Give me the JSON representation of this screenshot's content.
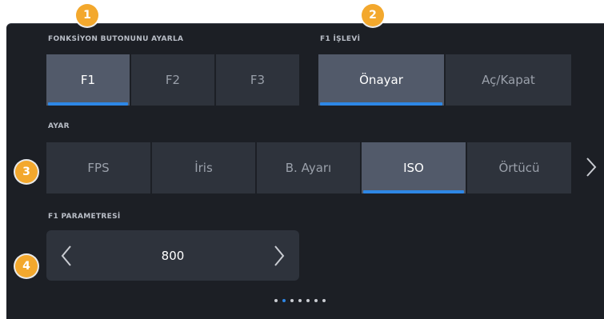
{
  "markers": [
    "1",
    "2",
    "3",
    "4"
  ],
  "function_button": {
    "label": "FONKSİYON BUTONUNU AYARLA",
    "options": [
      "F1",
      "F2",
      "F3"
    ],
    "selected": "F1"
  },
  "f1_function": {
    "label": "F1 İŞLEVİ",
    "options": [
      "Önayar",
      "Aç/Kapat"
    ],
    "selected": "Önayar"
  },
  "setting": {
    "label": "AYAR",
    "options": [
      "FPS",
      "İris",
      "B. Ayarı",
      "ISO",
      "Örtücü"
    ],
    "selected": "ISO",
    "next_icon": "chevron-right-icon"
  },
  "parameter": {
    "label": "F1 PARAMETRESİ",
    "value": "800",
    "prev_icon": "chevron-left-icon",
    "next_icon": "chevron-right-icon"
  },
  "pagination": {
    "total": 7,
    "current": 2
  },
  "colors": {
    "accent": "#2e87e6",
    "marker": "#f3a82d",
    "button": "#2e333c",
    "button_active": "#525a6a",
    "background": "#1c1f25"
  }
}
